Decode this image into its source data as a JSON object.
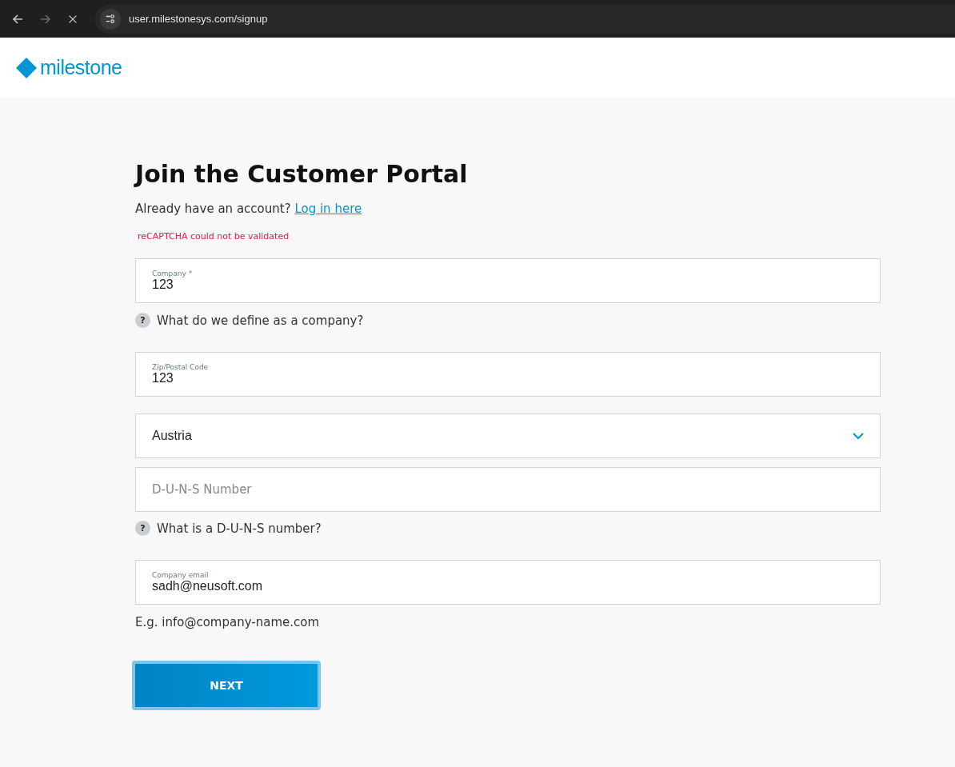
{
  "browser": {
    "url": "user.milestonesys.com/signup",
    "back_disabled": false,
    "forward_disabled": true
  },
  "logo": {
    "text": "milestone"
  },
  "title": "Join the Customer Portal",
  "account_prompt": {
    "text": "Already have an account?",
    "link": "Log in here"
  },
  "error": "reCAPTCHA could not be validated",
  "form": [
    {
      "kind": "field",
      "label": "Company *",
      "value": "123"
    },
    {
      "kind": "help",
      "text": "What do we define as a company?",
      "icon": "?"
    },
    {
      "kind": "field",
      "label": "Zip/Postal Code",
      "value": "123"
    },
    {
      "kind": "select",
      "value": "Austria"
    },
    {
      "kind": "empty",
      "placeholder": "D-U-N-S Number"
    },
    {
      "kind": "help",
      "text": "What is a D-U-N-S number?",
      "icon": "?"
    },
    {
      "kind": "field",
      "label": "Company email",
      "value": "sadh@neusoft.com"
    },
    {
      "kind": "hint",
      "text": "E.g. info@company-name.com"
    }
  ],
  "next_button": {
    "label": "NEXT",
    "focused": true
  }
}
